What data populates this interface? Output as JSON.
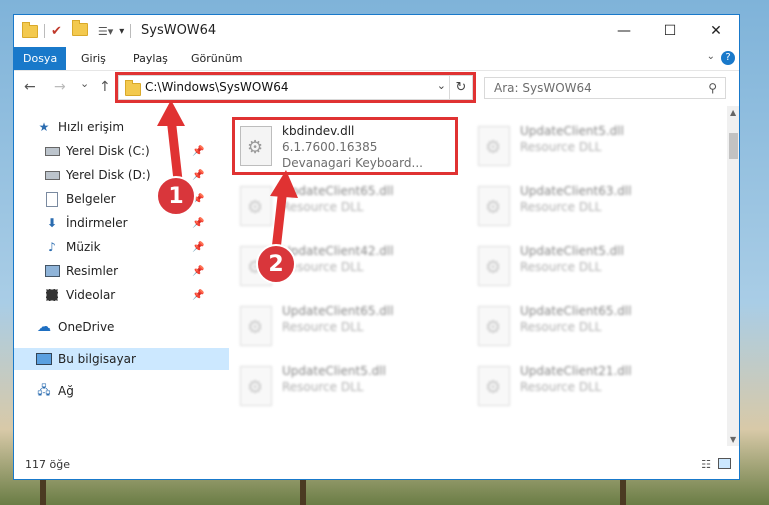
{
  "window": {
    "title": "SysWOW64",
    "minimize": "—",
    "maximize": "☐",
    "close": "✕"
  },
  "ribbon": {
    "tabs": [
      "Dosya",
      "Giriş",
      "Paylaş",
      "Görünüm"
    ],
    "help": "?"
  },
  "nav": {
    "back": "←",
    "forward": "→",
    "recent": "⌄",
    "up": "↑"
  },
  "address": {
    "path": "C:\\Windows\\SysWOW64"
  },
  "search": {
    "placeholder": "Ara: SysWOW64"
  },
  "sidebar": {
    "items": [
      {
        "label": "Hızlı erişim",
        "icon": "star-icon",
        "pinned": false
      },
      {
        "label": "Yerel Disk (C:)",
        "icon": "drive-icon",
        "pinned": true
      },
      {
        "label": "Yerel Disk (D:)",
        "icon": "drive-icon",
        "pinned": true
      },
      {
        "label": "Belgeler",
        "icon": "documents-icon",
        "pinned": true
      },
      {
        "label": "İndirmeler",
        "icon": "download-icon",
        "pinned": true
      },
      {
        "label": "Müzik",
        "icon": "music-icon",
        "pinned": true
      },
      {
        "label": "Resimler",
        "icon": "pictures-icon",
        "pinned": true
      },
      {
        "label": "Videolar",
        "icon": "video-icon",
        "pinned": true
      },
      {
        "label": "OneDrive",
        "icon": "cloud-icon",
        "pinned": false
      },
      {
        "label": "Bu bilgisayar",
        "icon": "computer-icon",
        "pinned": false,
        "selected": true
      },
      {
        "label": "Ağ",
        "icon": "network-icon",
        "pinned": false
      }
    ]
  },
  "files": [
    {
      "name": "kbdindev.dll",
      "version": "6.1.7600.16385",
      "description": "Devanagari Keyboard...",
      "highlighted": true
    },
    {
      "name": "UpdateClient5.dll",
      "description": "Resource DLL"
    },
    {
      "name": "UpdateClient65.dll",
      "description": "Resource DLL"
    },
    {
      "name": "UpdateClient63.dll",
      "description": "Resource DLL"
    },
    {
      "name": "UpdateClient42.dll",
      "description": "Resource DLL"
    },
    {
      "name": "UpdateClient5.dll",
      "description": "Resource DLL"
    },
    {
      "name": "UpdateClient65.dll",
      "description": "Resource DLL"
    },
    {
      "name": "UpdateClient65.dll",
      "description": "Resource DLL"
    },
    {
      "name": "UpdateClient5.dll",
      "description": "Resource DLL"
    },
    {
      "name": "UpdateClient21.dll",
      "description": "Resource DLL"
    }
  ],
  "status": {
    "count": "117 öğe"
  },
  "annotations": {
    "badge1": "1",
    "badge2": "2",
    "highlight_color": "#e03232"
  },
  "colors": {
    "accent": "#1979ca"
  }
}
